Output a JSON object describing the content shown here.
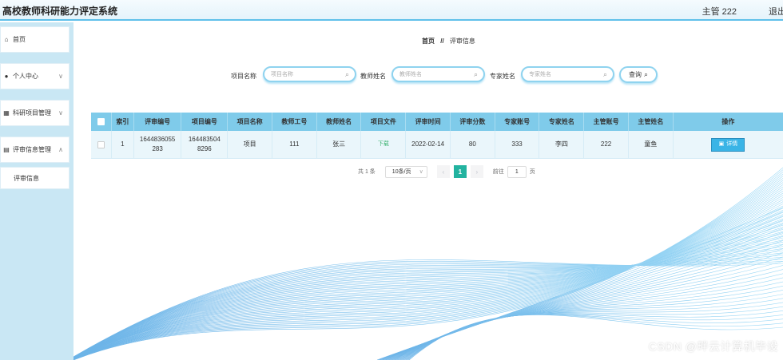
{
  "header": {
    "title": "高校教师科研能力评定系统",
    "user_info": "主管 222",
    "logout_label": "退出"
  },
  "sidebar": {
    "items": [
      {
        "icon": "home-icon",
        "label": "首页"
      },
      {
        "icon": "user-icon",
        "label": "个人中心"
      },
      {
        "icon": "grid-icon",
        "label": "科研项目管理"
      },
      {
        "icon": "chart-icon",
        "label": "评审信息管理"
      }
    ],
    "sub_items": [
      {
        "label": "评审信息"
      }
    ]
  },
  "breadcrumb": {
    "home": "首页",
    "separator": "//",
    "current": "评审信息"
  },
  "search": {
    "project_name_label": "项目名称",
    "project_name_placeholder": "项目名称",
    "teacher_name_label": "教师姓名",
    "teacher_name_placeholder": "教师姓名",
    "expert_name_label": "专家姓名",
    "expert_name_placeholder": "专家姓名",
    "query_label": "查询"
  },
  "table": {
    "columns": [
      "索引",
      "评审编号",
      "项目编号",
      "项目名称",
      "教师工号",
      "教师姓名",
      "项目文件",
      "评审时间",
      "评审分数",
      "专家账号",
      "专家姓名",
      "主管账号",
      "主管姓名",
      "操作"
    ],
    "rows": [
      {
        "index": "1",
        "review_no": "1644836055283",
        "review_no_line1": "1644836055",
        "review_no_line2": "283",
        "project_no": "1644835048296",
        "project_no_line1": "164483504",
        "project_no_line2": "8296",
        "project_name": "项目",
        "teacher_id": "111",
        "teacher_name": "张三",
        "file": "下载",
        "review_time": "2022-02-14",
        "score": "80",
        "expert_account": "333",
        "expert_name": "李四",
        "manager_account": "222",
        "manager_name": "童鱼",
        "action_label": "详情"
      }
    ]
  },
  "pagination": {
    "total": "共 1 条",
    "page_size": "10条/页",
    "prev": "‹",
    "current_page": "1",
    "next": "›",
    "goto_label": "前往",
    "goto_value": "1",
    "goto_suffix": "页"
  },
  "watermark": "CSDN @畔云计算机毕设",
  "colors": {
    "accent": "#5fc0ea",
    "sidebar_bg": "#c9e7f4",
    "table_header": "#7fcbea",
    "row_bg": "#eaf6fb",
    "detail_button": "#3ab4e6",
    "active_page": "#23b3a0"
  }
}
